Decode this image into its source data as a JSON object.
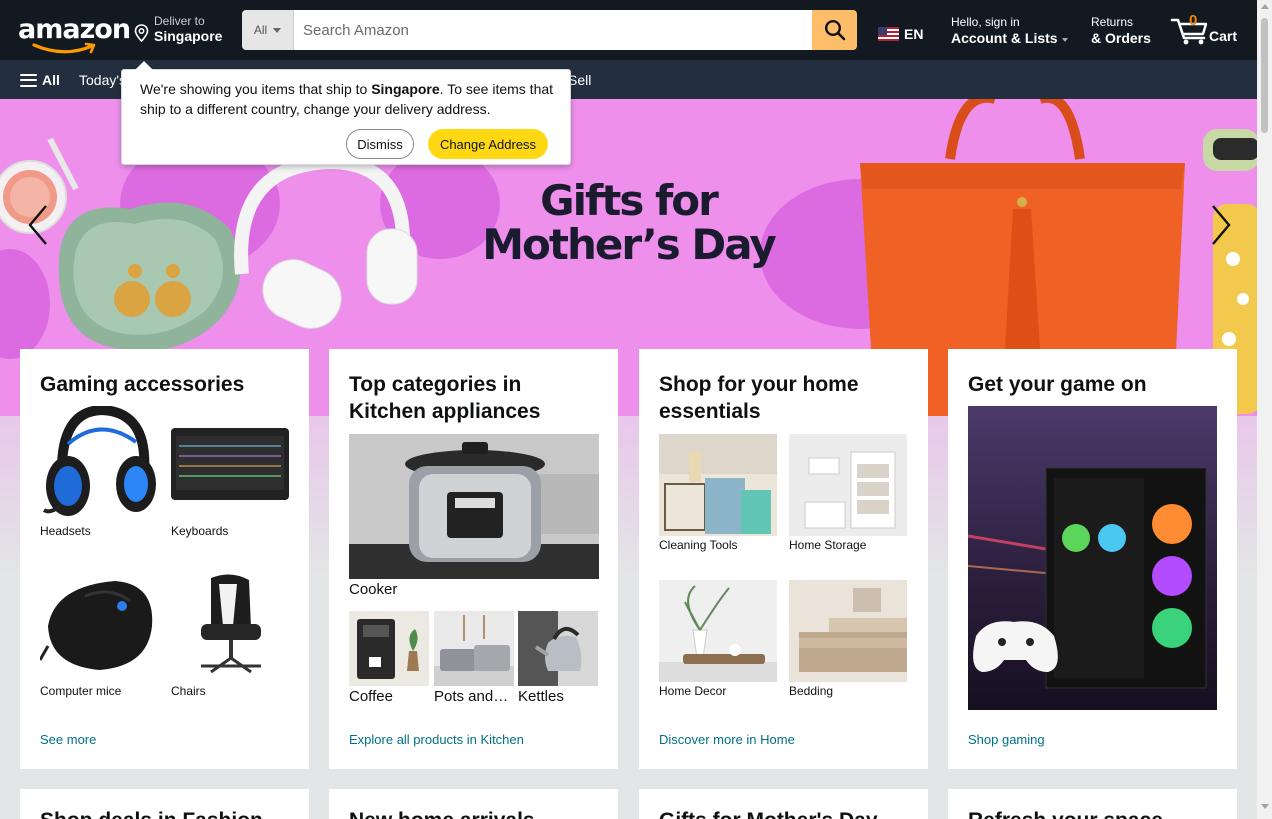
{
  "header": {
    "logo_text": "amazon",
    "deliver_line1": "Deliver to",
    "deliver_line2": "Singapore",
    "search_category": "All",
    "search_placeholder": "Search Amazon",
    "language": "EN",
    "account_line1": "Hello, sign in",
    "account_line2": "Account & Lists",
    "returns_line1": "Returns",
    "returns_line2": "& Orders",
    "cart_count": "0",
    "cart_label": "Cart"
  },
  "subnav": {
    "all_label": "All",
    "items": [
      "Today's",
      "Sell"
    ]
  },
  "popover": {
    "text_before": "We're showing you items that ship to ",
    "location": "Singapore",
    "text_after": ". To see items that ship to a different country, change your delivery address.",
    "dismiss_label": "Dismiss",
    "change_label": "Change Address"
  },
  "hero": {
    "line1": "Gifts for",
    "line2": "Mother’s Day"
  },
  "cards": [
    {
      "title": "Gaming accessories",
      "items": [
        "Headsets",
        "Keyboards",
        "Computer mice",
        "Chairs"
      ],
      "link": "See more"
    },
    {
      "title": "Top categories in Kitchen appliances",
      "main_item": "Cooker",
      "items": [
        "Coffee",
        "Pots and…",
        "Kettles"
      ],
      "link": "Explore all products in Kitchen"
    },
    {
      "title": "Shop for your home essentials",
      "items": [
        "Cleaning Tools",
        "Home Storage",
        "Home Decor",
        "Bedding"
      ],
      "link": "Discover more in Home"
    },
    {
      "title": "Get your game on",
      "link": "Shop gaming"
    }
  ],
  "bottom_cards": [
    "Shop deals in Fashion",
    "New home arrivals",
    "Gifts for Mother's Day",
    "Refresh your space"
  ],
  "colors": {
    "nav_dark": "#131921",
    "nav_sub": "#232f3e",
    "search_button": "#febd69",
    "primary_button": "#ffd814",
    "cart_count": "#f08804",
    "link": "#007185",
    "hero_bg": "#ee8fec"
  }
}
